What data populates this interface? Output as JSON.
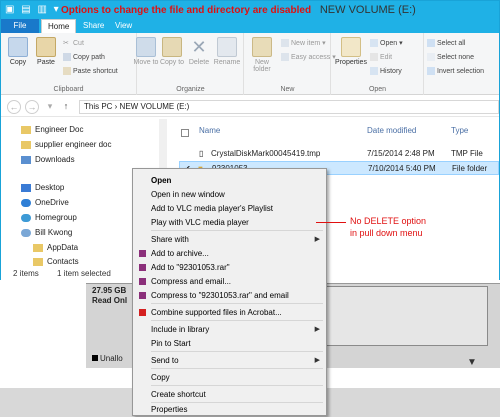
{
  "window": {
    "title_note": "Options to change the file and directory are disabled",
    "title_volume": "NEW VOLUME (E:)"
  },
  "tabs": [
    {
      "label": "File"
    },
    {
      "label": "Home"
    },
    {
      "label": "Share"
    },
    {
      "label": "View"
    }
  ],
  "ribbon": {
    "clipboard": {
      "label": "Clipboard",
      "copy": "Copy",
      "paste": "Paste",
      "cut": "Cut",
      "copy_path": "Copy path",
      "paste_shortcut": "Paste shortcut"
    },
    "organize": {
      "label": "Organize",
      "move_to": "Move to",
      "copy_to": "Copy to",
      "delete": "Delete",
      "rename": "Rename"
    },
    "new": {
      "label": "New",
      "new_folder": "New folder",
      "new_item": "New item",
      "easy_access": "Easy access"
    },
    "open": {
      "label": "Open",
      "properties": "Properties",
      "open": "Open",
      "edit": "Edit",
      "history": "History"
    },
    "select": {
      "select_all": "Select all",
      "select_none": "Select none",
      "invert": "Invert selection"
    }
  },
  "address": {
    "path": "This PC  ›  NEW VOLUME (E:)"
  },
  "nav_items": [
    "Engineer Doc",
    "supplier engineer doc",
    "Downloads",
    "Desktop",
    "OneDrive",
    "Homegroup",
    "Bill Kwong",
    "AppData",
    "Contacts"
  ],
  "columns": {
    "name": "Name",
    "date": "Date modified",
    "type": "Type"
  },
  "files": [
    {
      "name": "CrystalDiskMark00045419.tmp",
      "date": "7/15/2014 2:48 PM",
      "type": "TMP File"
    },
    {
      "name": "92301053",
      "date": "7/10/2014 5:40 PM",
      "type": "File folder"
    }
  ],
  "status": {
    "count": "2 items",
    "selected": "1 item selected"
  },
  "background": {
    "size": "27.95 GB",
    "state": "Read Onl",
    "unalloc": "Unallo"
  },
  "context_menu": {
    "open": "Open",
    "open_new_window": "Open in new window",
    "vlc_add": "Add to VLC media player's Playlist",
    "vlc_play": "Play with VLC media player",
    "share_with": "Share with",
    "add_archive": "Add to archive...",
    "add_rar": "Add to \"92301053.rar\"",
    "compress_email": "Compress and email...",
    "compress_rar_email": "Compress to \"92301053.rar\" and email",
    "acrobat": "Combine supported files in Acrobat...",
    "include_library": "Include in library",
    "pin_start": "Pin to Start",
    "send_to": "Send to",
    "copy": "Copy",
    "create_shortcut": "Create shortcut",
    "properties": "Properties"
  },
  "annotation": {
    "line1": "No DELETE option",
    "line2": "in pull down menu"
  },
  "colors": {
    "accent": "#1fb1e6",
    "annotation_red": "#e01010",
    "selection": "#cce8ff"
  }
}
